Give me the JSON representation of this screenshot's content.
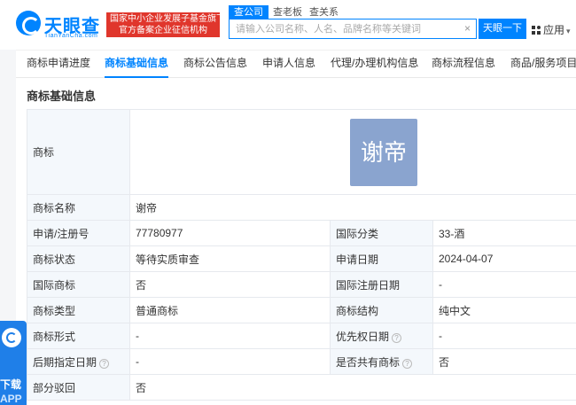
{
  "brand": {
    "name": "天眼查",
    "sub": "TianYanCha.com",
    "badge_line1": "国家中小企业发展子基金旗下",
    "badge_line2": "官方备案企业征信机构"
  },
  "search": {
    "tabs": [
      "查公司",
      "查老板",
      "查关系"
    ],
    "placeholder": "请输入公司名称、人名、品牌名称等关键词",
    "clear": "×",
    "button": "天眼一下"
  },
  "apps_label": "应用",
  "nav_tabs": [
    "商标申请进度",
    "商标基础信息",
    "商标公告信息",
    "申请人信息",
    "代理/办理机构信息",
    "商标流程信息",
    "商品/服务项目"
  ],
  "active_tab": 1,
  "section_title": "商标基础信息",
  "trademark": {
    "logo_label": "商标",
    "logo_text": "谢帝",
    "name_label": "商标名称",
    "name": "谢帝",
    "rows": [
      {
        "l1": "申请/注册号",
        "v1": "77780977",
        "l2": "国际分类",
        "v2": "33-酒"
      },
      {
        "l1": "商标状态",
        "v1": "等待实质审查",
        "l2": "申请日期",
        "v2": "2024-04-07"
      },
      {
        "l1": "国际商标",
        "v1": "否",
        "l2": "国际注册日期",
        "v2": "-"
      },
      {
        "l1": "商标类型",
        "v1": "普通商标",
        "l2": "商标结构",
        "v2": "纯中文"
      },
      {
        "l1": "商标形式",
        "v1": "-",
        "l2": "优先权日期",
        "v2": "-"
      },
      {
        "l1": "后期指定日期",
        "v1": "-",
        "l2": "是否共有商标",
        "v2": "否"
      }
    ],
    "partial_label": "部分驳回",
    "partial_value": "否"
  },
  "download": {
    "line1": "下载",
    "line2": "APP"
  },
  "colors": {
    "brand": "#0084ff",
    "badge": "#e0362c",
    "label_bg": "#f4f8fc",
    "logo_tile": "#8aa4cf"
  }
}
